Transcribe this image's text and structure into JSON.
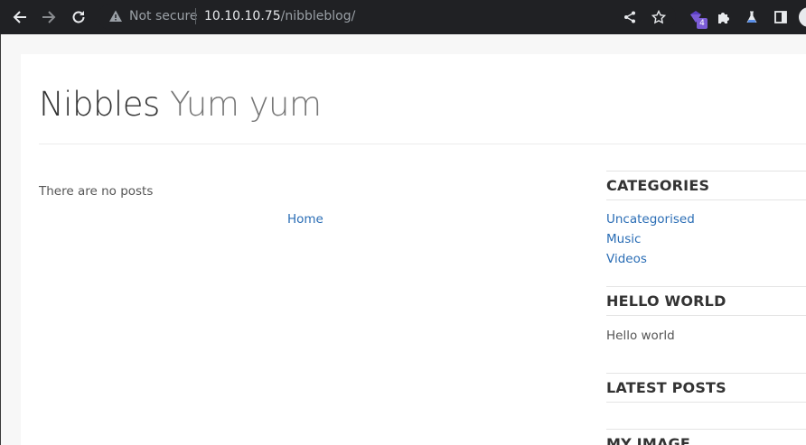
{
  "browser": {
    "security_label": "Not secure",
    "url_host": "10.10.10.75",
    "url_path": "/nibbleblog/",
    "extension_badge": "4",
    "icons": [
      "back-arrow-icon",
      "forward-arrow-icon",
      "reload-icon",
      "warning-icon",
      "share-icon",
      "star-icon",
      "extension-gem-icon",
      "puzzle-icon",
      "lab-flask-icon",
      "side-panel-icon",
      "profile-avatar"
    ]
  },
  "site": {
    "title": "Nibbles",
    "slogan": "Yum yum"
  },
  "main": {
    "empty_message": "There are no posts",
    "home_link": "Home"
  },
  "sidebar": {
    "categories_title": "CATEGORIES",
    "categories": [
      "Uncategorised",
      "Music",
      "Videos"
    ],
    "hello_title": "HELLO WORLD",
    "hello_text": "Hello world",
    "latest_title": "LATEST POSTS",
    "image_title": "MY IMAGE"
  },
  "colors": {
    "toolbar_bg": "#202124",
    "link": "#2a6db5",
    "page_bg": "#f7f7f7"
  }
}
